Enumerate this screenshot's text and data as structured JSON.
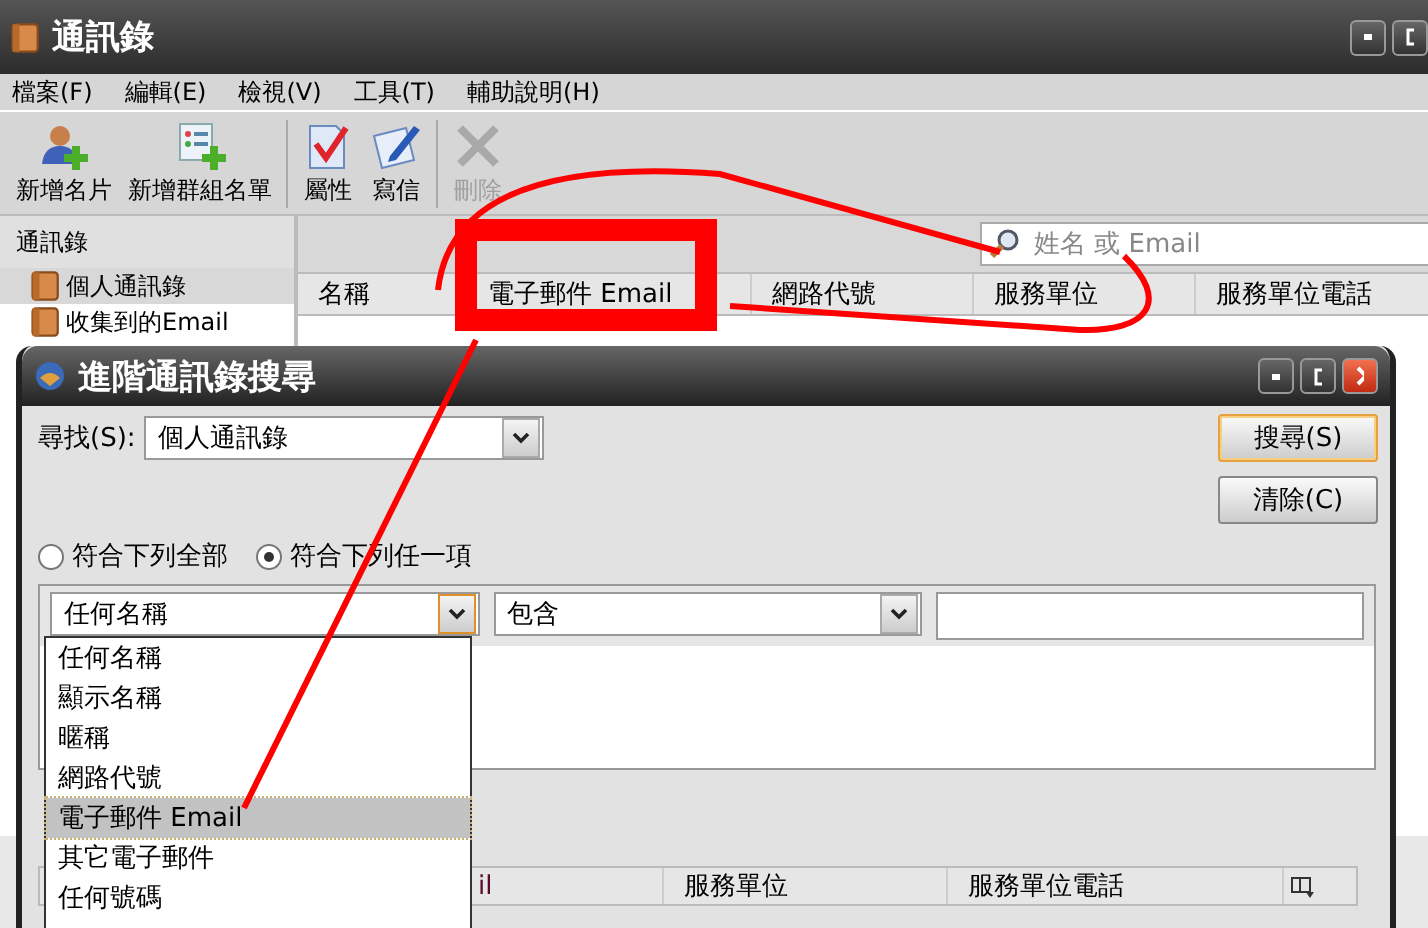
{
  "main_window": {
    "title": "通訊錄",
    "menu": [
      "檔案(F)",
      "編輯(E)",
      "檢視(V)",
      "工具(T)",
      "輔助說明(H)"
    ],
    "toolbar": [
      {
        "label": "新增名片",
        "disabled": false
      },
      {
        "label": "新增群組名單",
        "disabled": false
      },
      {
        "label": "屬性",
        "disabled": false
      },
      {
        "label": "寫信",
        "disabled": false
      },
      {
        "label": "刪除",
        "disabled": true
      }
    ],
    "sidebar": {
      "header": "通訊錄",
      "items": [
        {
          "label": "個人通訊錄",
          "selected": true
        },
        {
          "label": "收集到的Email",
          "selected": false
        }
      ]
    },
    "search": {
      "placeholder": "姓名 或 Email"
    },
    "columns": [
      "名稱",
      "電子郵件 Email",
      "網路代號",
      "服務單位",
      "服務單位電話"
    ]
  },
  "dialog": {
    "title": "進階通訊錄搜尋",
    "find_label": "尋找(S):",
    "find_value": "個人通訊錄",
    "buttons": [
      {
        "label": "搜尋(S)",
        "default": true
      },
      {
        "label": "清除(C)",
        "default": false
      }
    ],
    "match_options": [
      {
        "label": "符合下列全部",
        "selected": false
      },
      {
        "label": "符合下列任一項",
        "selected": true
      }
    ],
    "criterion": {
      "field": "任何名稱",
      "operator": "包含"
    },
    "field_options": [
      {
        "label": "任何名稱",
        "selected": false
      },
      {
        "label": "顯示名稱",
        "selected": false
      },
      {
        "label": "暱稱",
        "selected": false
      },
      {
        "label": "網路代號",
        "selected": false
      },
      {
        "label": "電子郵件 Email",
        "selected": true
      },
      {
        "label": "其它電子郵件",
        "selected": false
      },
      {
        "label": "任何號碼",
        "selected": false
      }
    ],
    "result_columns": [
      "il",
      "服務單位",
      "服務單位電話"
    ]
  }
}
